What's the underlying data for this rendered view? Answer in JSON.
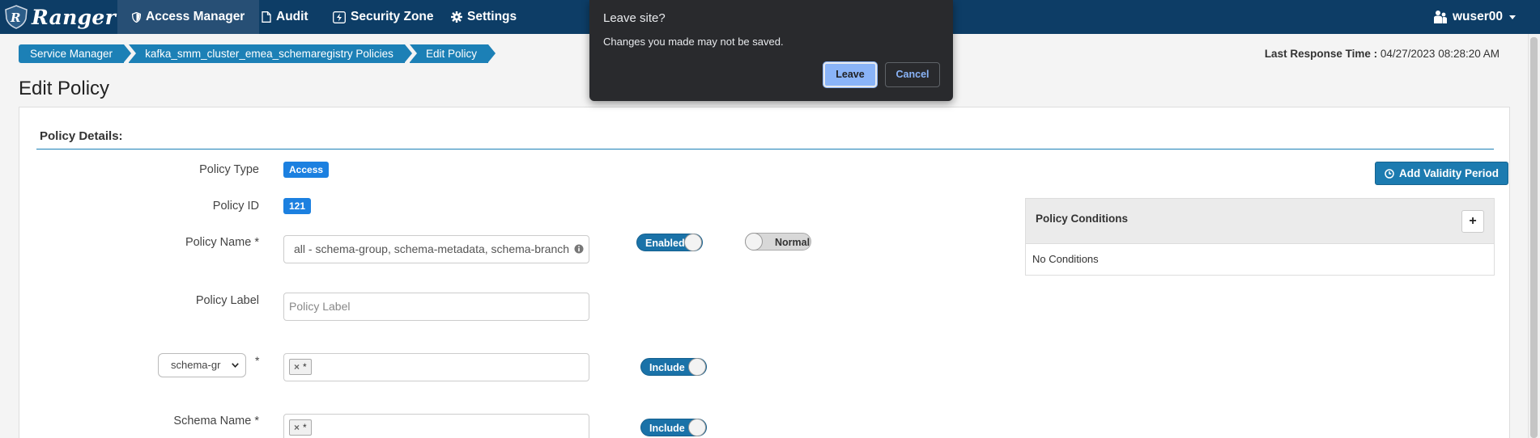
{
  "navbar": {
    "brand": "Ranger",
    "items": [
      {
        "label": "Access Manager",
        "active": true
      },
      {
        "label": "Audit",
        "active": false
      },
      {
        "label": "Security Zone",
        "active": false
      },
      {
        "label": "Settings",
        "active": false
      }
    ],
    "user": "wuser00"
  },
  "breadcrumb": [
    "Service Manager",
    "kafka_smm_cluster_emea_schemaregistry Policies",
    "Edit Policy"
  ],
  "last_response": {
    "label": "Last Response Time :",
    "value": "04/27/2023 08:28:20 AM"
  },
  "page_title": "Edit Policy",
  "policy_details": {
    "section_title": "Policy Details:",
    "policy_type": {
      "label": "Policy Type",
      "value": "Access"
    },
    "policy_id": {
      "label": "Policy ID",
      "value": "121"
    },
    "policy_name": {
      "label": "Policy Name *",
      "value": "all - schema-group, schema-metadata, schema-branch",
      "enabled_toggle": "Enabled",
      "normal_toggle": "Normal"
    },
    "policy_label": {
      "label": "Policy Label",
      "placeholder": "Policy Label"
    },
    "resource_select": {
      "value": "schema-gr",
      "required": "*",
      "token": "*",
      "toggle": "Include"
    },
    "schema_name": {
      "label": "Schema Name *",
      "token": "*",
      "toggle": "Include"
    }
  },
  "validity_button": "Add Validity Period",
  "conditions": {
    "title": "Policy Conditions",
    "add": "+",
    "empty": "No Conditions"
  },
  "dialog": {
    "title": "Leave site?",
    "message": "Changes you made may not be saved.",
    "leave": "Leave",
    "cancel": "Cancel"
  },
  "colors": {
    "navbar": "#0d3d66",
    "accent": "#1c80b6",
    "dialog_bg": "#292a2d",
    "dialog_primary": "#8ab4f8"
  }
}
